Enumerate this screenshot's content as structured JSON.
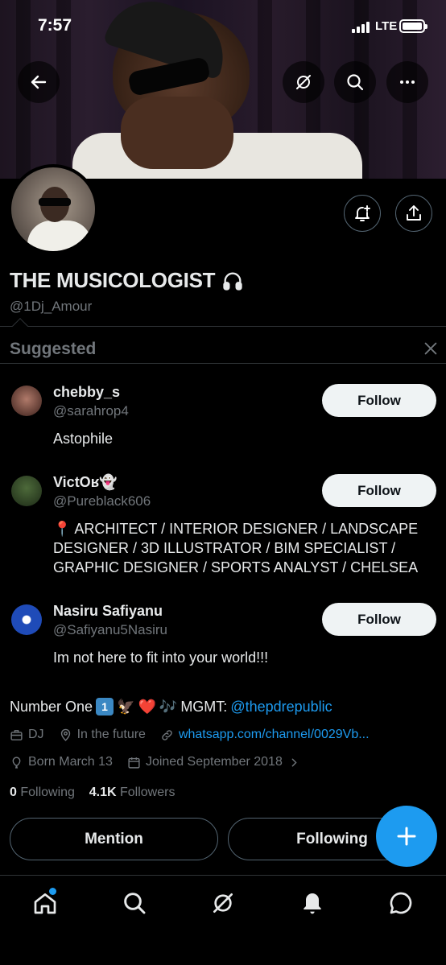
{
  "status_bar": {
    "time": "7:57",
    "network": "LTE"
  },
  "profile": {
    "display_name": "THE MUSICOLOGIST",
    "handle": "@1Dj_Amour",
    "bio_text": "Number One",
    "bio_mgmt_label": "MGMT:",
    "bio_mention": "@thepdrepublic",
    "bio_emoji_one": "1",
    "category": "DJ",
    "location": "In the future",
    "website": "whatsapp.com/channel/0029Vb...",
    "born": "Born March 13",
    "joined": "Joined September 2018",
    "following_count": "0",
    "following_label": "Following",
    "followers_count": "4.1K",
    "followers_label": "Followers"
  },
  "suggested": {
    "title": "Suggested",
    "items": [
      {
        "name": "chebby_s",
        "handle": "@sarahrop4",
        "bio": "Astophile",
        "button": "Follow"
      },
      {
        "name": "VictOʁ👻",
        "handle": "@Pureblack606",
        "bio": "📍 ARCHITECT / INTERIOR DESIGNER / LANDSCAPE DESIGNER / 3D ILLUSTRATOR / BIM SPECIALIST / GRAPHIC DESIGNER / SPORTS ANALYST / CHELSEA",
        "button": "Follow"
      },
      {
        "name": "Nasiru Safiyanu",
        "handle": "@Safiyanu5Nasiru",
        "bio": "Im not here to fit into your world!!!",
        "button": "Follow"
      }
    ]
  },
  "actions": {
    "mention": "Mention",
    "following": "Following"
  },
  "colors": {
    "accent": "#1d9bf0",
    "background": "#000000",
    "text": "#e7e9ea",
    "muted": "#71767b"
  },
  "icons": [
    "back-arrow-icon",
    "grok-icon",
    "search-icon",
    "more-icon",
    "bell-plus-icon",
    "share-icon",
    "close-icon",
    "briefcase-icon",
    "location-icon",
    "link-icon",
    "balloon-icon",
    "calendar-icon",
    "chevron-right-icon",
    "plus-icon",
    "home-icon",
    "messages-icon"
  ]
}
